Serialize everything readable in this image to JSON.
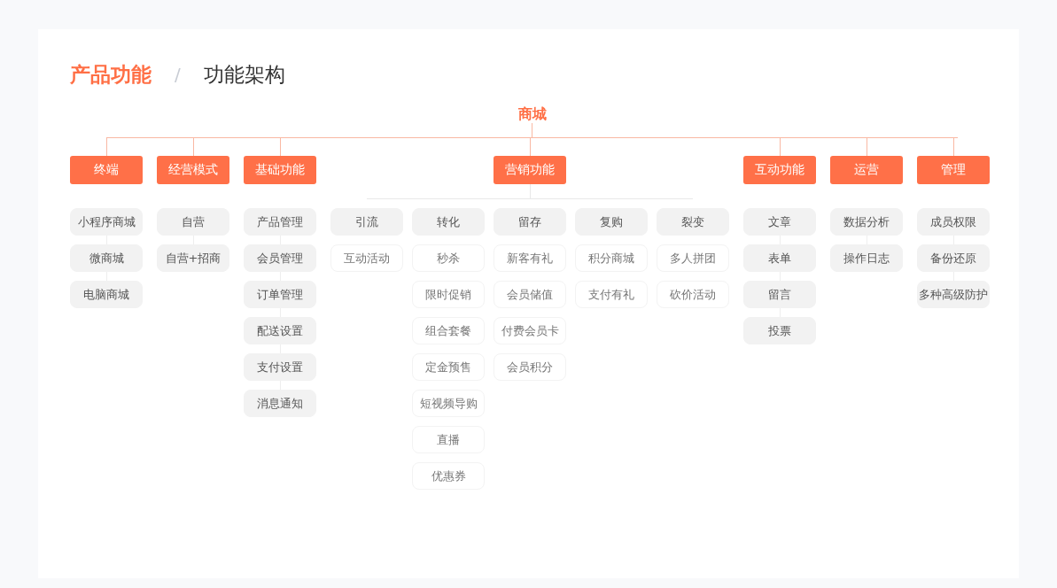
{
  "breadcrumb": {
    "section": "产品功能",
    "separator": "/",
    "page": "功能架构"
  },
  "root": "商城",
  "categories": [
    {
      "kind": "list",
      "label": "终端",
      "items": [
        "小程序商城",
        "微商城",
        "电脑商城"
      ]
    },
    {
      "kind": "list",
      "label": "经营模式",
      "items": [
        "自营",
        "自营+招商"
      ]
    },
    {
      "kind": "list",
      "label": "基础功能",
      "items": [
        "产品管理",
        "会员管理",
        "订单管理",
        "配送设置",
        "支付设置",
        "消息通知"
      ]
    },
    {
      "kind": "groups",
      "label": "营销功能",
      "groups": [
        {
          "label": "引流",
          "items": [
            "互动活动"
          ]
        },
        {
          "label": "转化",
          "items": [
            "秒杀",
            "限时促销",
            "组合套餐",
            "定金预售",
            "短视频导购",
            "直播",
            "优惠券"
          ]
        },
        {
          "label": "留存",
          "items": [
            "新客有礼",
            "会员储值",
            "付费会员卡",
            "会员积分"
          ]
        },
        {
          "label": "复购",
          "items": [
            "积分商城",
            "支付有礼"
          ]
        },
        {
          "label": "裂变",
          "items": [
            "多人拼团",
            "砍价活动"
          ]
        }
      ]
    },
    {
      "kind": "list",
      "label": "互动功能",
      "items": [
        "文章",
        "表单",
        "留言",
        "投票"
      ]
    },
    {
      "kind": "list",
      "label": "运营",
      "items": [
        "数据分析",
        "操作日志"
      ]
    },
    {
      "kind": "list",
      "label": "管理",
      "items": [
        "成员权限",
        "备份还原",
        "多种高级防护"
      ]
    }
  ]
}
